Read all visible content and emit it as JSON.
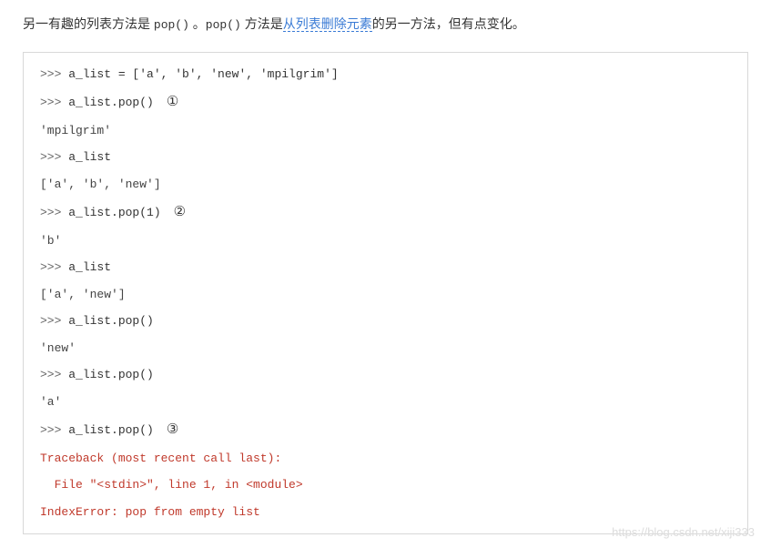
{
  "intro": {
    "text1": "另一有趣的列表方法是 ",
    "mono1": "pop()",
    "text2": " 。",
    "mono2": "pop()",
    "text3": " 方法是",
    "link": "从列表删除元素",
    "text4": "的另一方法，但有点变化。"
  },
  "code": {
    "l1_prompt": ">>> ",
    "l1_code": "a_list = ['a', 'b', 'new', 'mpilgrim']",
    "l2_prompt": ">>> ",
    "l2_code": "a_list.pop()",
    "l2_mark": "①",
    "l3_out": "'mpilgrim'",
    "l4_prompt": ">>> ",
    "l4_code": "a_list",
    "l5_out": "['a', 'b', 'new']",
    "l6_prompt": ">>> ",
    "l6_code": "a_list.pop(1)",
    "l6_mark": "②",
    "l7_out": "'b'",
    "l8_prompt": ">>> ",
    "l8_code": "a_list",
    "l9_out": "['a', 'new']",
    "l10_prompt": ">>> ",
    "l10_code": "a_list.pop()",
    "l11_out": "'new'",
    "l12_prompt": ">>> ",
    "l12_code": "a_list.pop()",
    "l13_out": "'a'",
    "l14_prompt": ">>> ",
    "l14_code": "a_list.pop()",
    "l14_mark": "③",
    "l15_err": "Traceback (most recent call last):",
    "l16_err": "  File \"<stdin>\", line 1, in <module>",
    "l17_err": "IndexError: pop from empty list"
  },
  "watermark": "https://blog.csdn.net/xiji333"
}
